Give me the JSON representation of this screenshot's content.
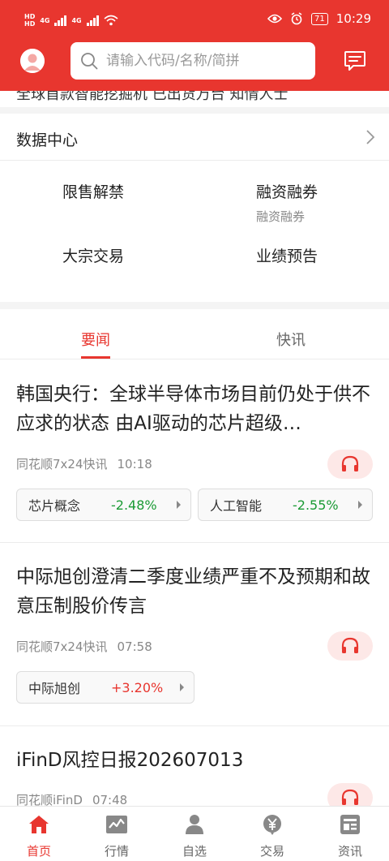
{
  "status_bar": {
    "time": "10:29",
    "battery": "71",
    "network_labels": [
      "HD",
      "HD",
      "4G",
      "4G"
    ]
  },
  "search": {
    "placeholder": "请输入代码/名称/简拼"
  },
  "cut_text": "全球首款智能挖掘机 已出货万台 知情人士",
  "data_center": {
    "title": "数据中心",
    "items": [
      {
        "label": "限售解禁",
        "sub": ""
      },
      {
        "label": "融资融券",
        "sub": "融资融券"
      },
      {
        "label": "大宗交易",
        "sub": ""
      },
      {
        "label": "业绩预告",
        "sub": ""
      }
    ]
  },
  "news_tabs": [
    {
      "label": "要闻",
      "active": true
    },
    {
      "label": "快讯",
      "active": false
    }
  ],
  "articles": [
    {
      "title": "韩国央行：全球半导体市场目前仍处于供不应求的状态 由AI驱动的芯片超级…",
      "source": "同花顺7x24快讯",
      "time": "10:18",
      "tags": [
        {
          "name": "芯片概念",
          "change": "-2.48%"
        },
        {
          "name": "人工智能",
          "change": "-2.55%"
        }
      ]
    },
    {
      "title": "中际旭创澄清二季度业绩严重不及预期和故意压制股价传言",
      "source": "同花顺7x24快讯",
      "time": "07:58",
      "tags": [
        {
          "name": "中际旭创",
          "change": "+3.20%"
        }
      ]
    },
    {
      "title": "iFinD风控日报202607013",
      "source": "同花顺iFinD",
      "time": "07:48",
      "tags": []
    }
  ],
  "colors": {
    "brand": "#e8362f",
    "down": "#1a9a34",
    "up": "#e8362f"
  },
  "bottom_nav": [
    {
      "label": "首页",
      "icon": "home-icon",
      "active": true
    },
    {
      "label": "行情",
      "icon": "chart-icon",
      "active": false
    },
    {
      "label": "自选",
      "icon": "person-icon",
      "active": false
    },
    {
      "label": "交易",
      "icon": "yuan-icon",
      "active": false
    },
    {
      "label": "资讯",
      "icon": "news-icon",
      "active": false
    }
  ]
}
